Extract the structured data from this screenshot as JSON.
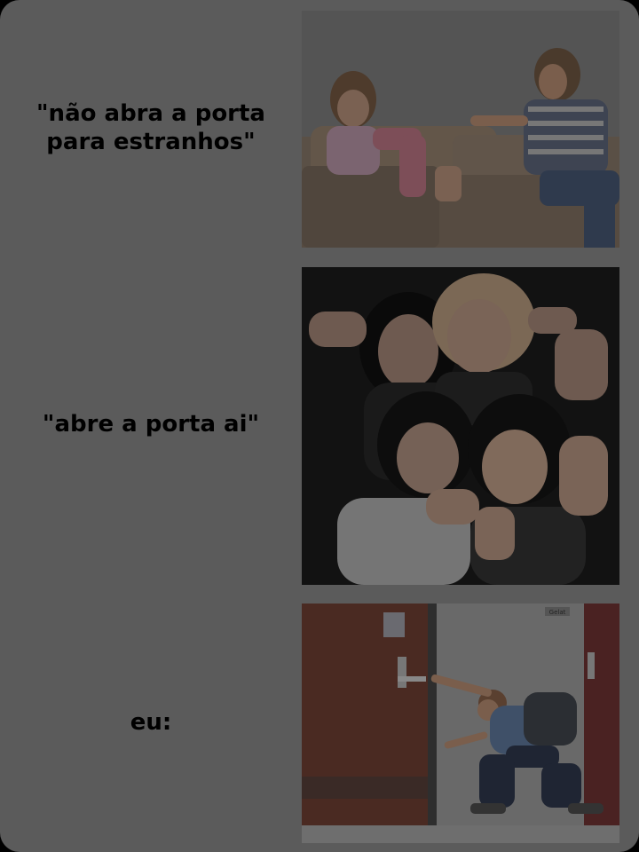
{
  "panels": [
    {
      "caption": "\"não abra a porta\npara estranhos\"",
      "image": "mother-scolding-daughter-on-sofa"
    },
    {
      "caption": "\"abre a porta ai\"",
      "image": "four-women-posing-with-hand-hearts"
    },
    {
      "caption": "eu:",
      "image": "man-kneeling-opening-door"
    }
  ],
  "door_sign": "Gelat"
}
